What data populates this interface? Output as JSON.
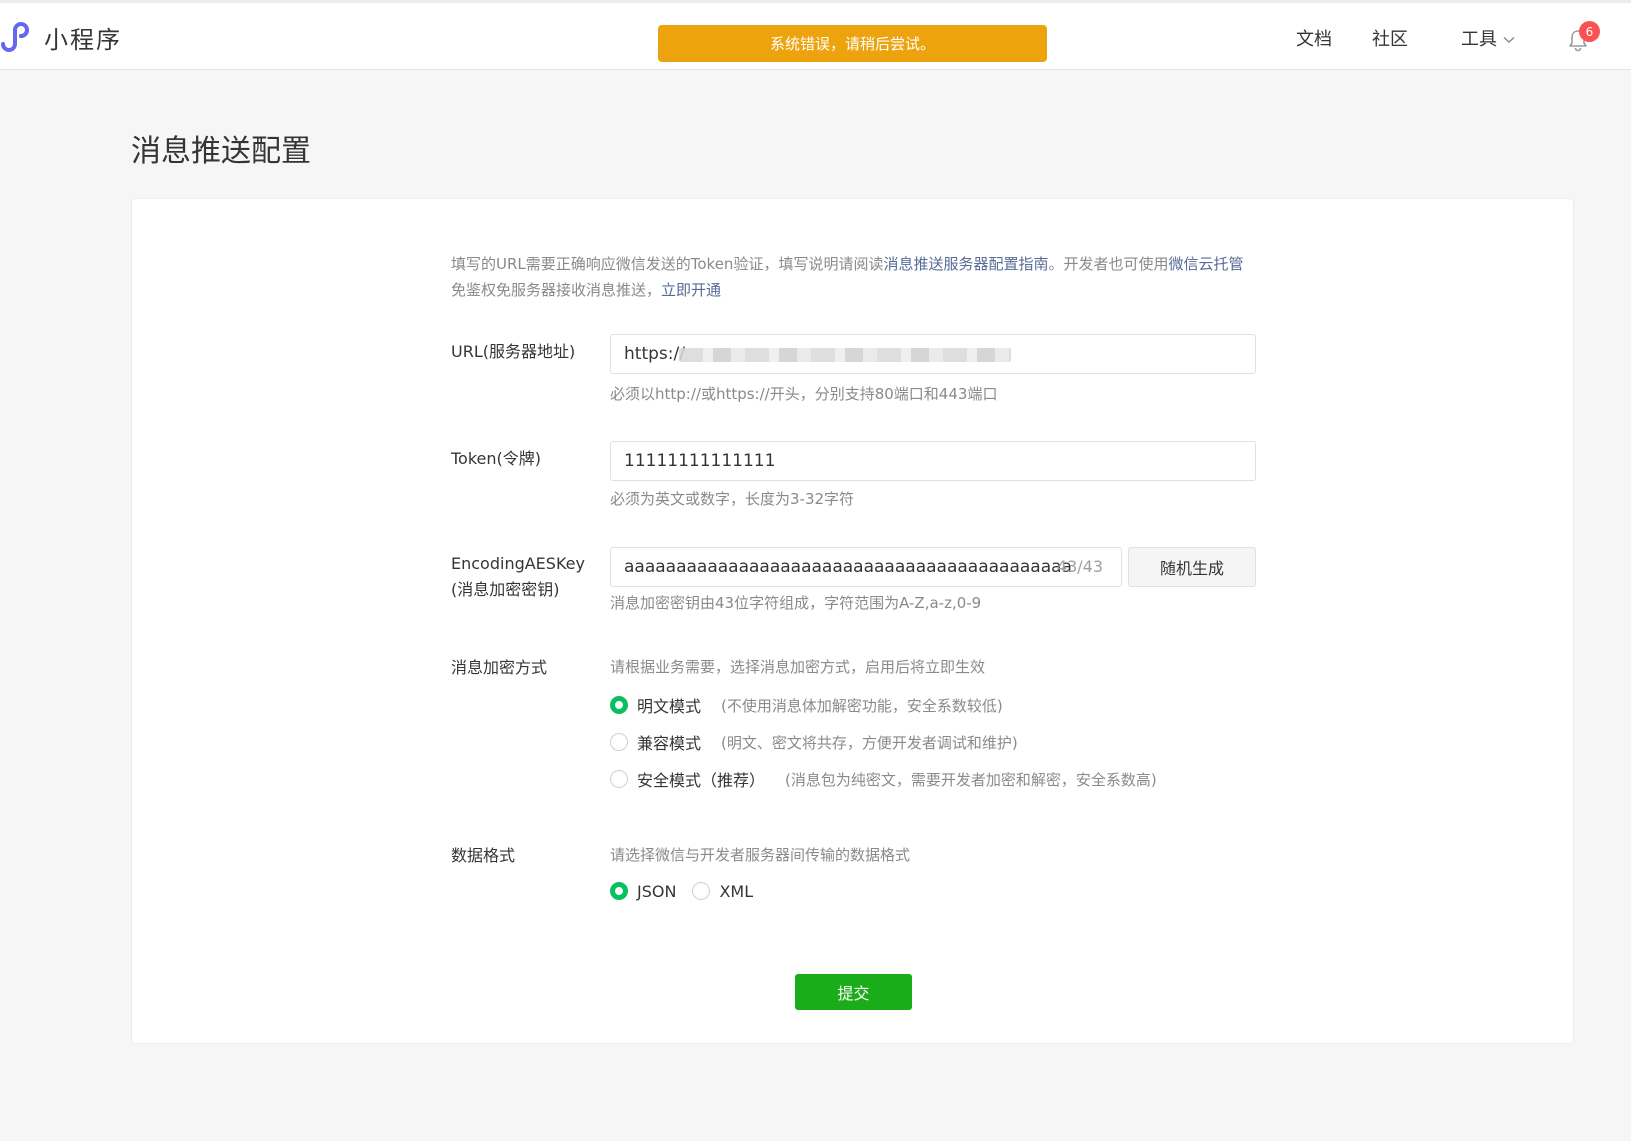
{
  "header": {
    "brand": "小程序",
    "toast": "系统错误，请稍后尝试。",
    "nav": {
      "docs": "文档",
      "community": "社区",
      "tools": "工具"
    },
    "notification_count": "6"
  },
  "page": {
    "title": "消息推送配置",
    "intro": {
      "part1": "填写的URL需要正确响应微信发送的Token验证，填写说明请阅读",
      "guide_link": "消息推送服务器配置指南",
      "part2": "。开发者也可使用",
      "cloud_link": "微信云托管",
      "part3": "免鉴权免服务器接收消息推送，",
      "enable_link": "立即开通"
    }
  },
  "form": {
    "url": {
      "label": "URL(服务器地址)",
      "value": "https://",
      "hint": "必须以http://或https://开头，分别支持80端口和443端口"
    },
    "token": {
      "label": "Token(令牌)",
      "value": "11111111111111",
      "hint": "必须为英文或数字，长度为3-32字符"
    },
    "aeskey": {
      "label_line1": "EncodingAESKey",
      "label_line2": "(消息加密密钥)",
      "value": "aaaaaaaaaaaaaaaaaaaaaaaaaaaaaaaaaaaaaaaaaaa",
      "counter": "43/43",
      "generate_button": "随机生成",
      "hint": "消息加密密钥由43位字符组成，字符范围为A-Z,a-z,0-9"
    },
    "encryption": {
      "label": "消息加密方式",
      "hint": "请根据业务需要，选择消息加密方式，启用后将立即生效",
      "options": [
        {
          "label": "明文模式",
          "desc": "(不使用消息体加解密功能，安全系数较低)",
          "checked": true
        },
        {
          "label": "兼容模式",
          "desc": "(明文、密文将共存，方便开发者调试和维护)",
          "checked": false
        },
        {
          "label": "安全模式（推荐）",
          "desc": "(消息包为纯密文，需要开发者加密和解密，安全系数高)",
          "checked": false
        }
      ]
    },
    "format": {
      "label": "数据格式",
      "hint": "请选择微信与开发者服务器间传输的数据格式",
      "options": [
        {
          "label": "JSON",
          "checked": true
        },
        {
          "label": "XML",
          "checked": false
        }
      ]
    },
    "submit_label": "提交"
  },
  "colors": {
    "accent_green": "#07c160",
    "submit_green": "#1aad19",
    "toast_orange": "#eca30e",
    "link_blue": "#576b95",
    "badge_red": "#fa5151"
  }
}
